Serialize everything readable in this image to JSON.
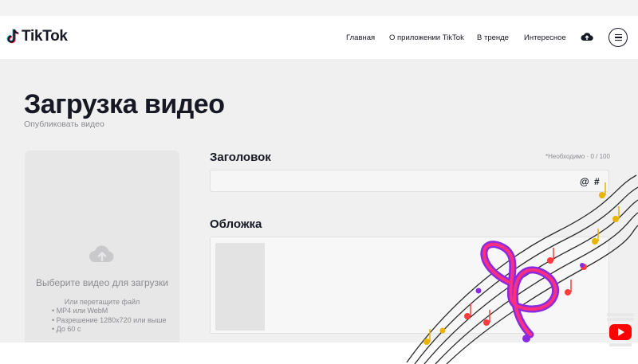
{
  "header": {
    "logo_text": "TikTok",
    "nav": [
      "Главная",
      "О приложении TikTok",
      "В тренде",
      "Интересное"
    ]
  },
  "page": {
    "title": "Загрузка видео",
    "subtitle": "Опубликовать видео"
  },
  "upload": {
    "title": "Выберите видео для загрузки",
    "or_text": "Или перетащите файл",
    "requirements": [
      "MP4 или WebM",
      "Разрешение 1280x720 или выше",
      "До 60 с"
    ]
  },
  "form": {
    "caption_label": "Заголовок",
    "counter": "*Необходимо · 0 / 100",
    "at_symbol": "@",
    "hash_symbol": "#",
    "cover_label": "Обложка"
  },
  "colors": {
    "brand_cyan": "#25f4ee",
    "brand_red": "#fe2c55",
    "text_primary": "#161823",
    "text_secondary": "#8a8b91"
  },
  "icons": {
    "logo": "tiktok-note-icon",
    "upload": "cloud-upload-icon",
    "menu": "hamburger-menu-icon"
  }
}
